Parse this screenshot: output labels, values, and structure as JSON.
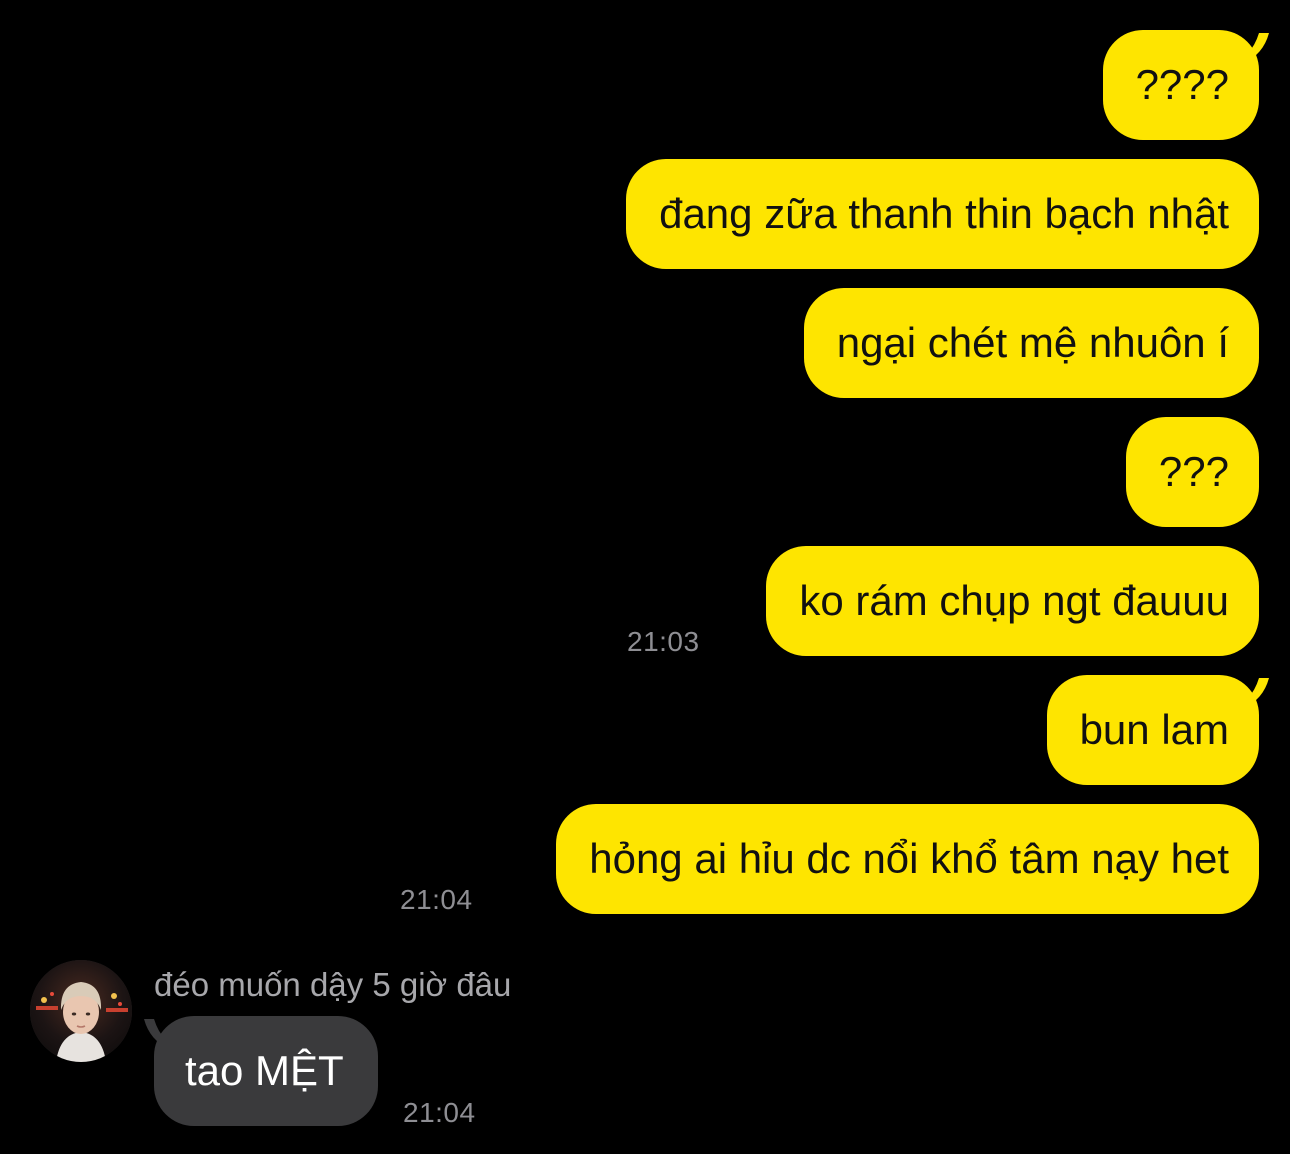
{
  "colors": {
    "background": "#000000",
    "outgoing_bubble": "#FEE500",
    "incoming_bubble": "#3a3a3c",
    "timestamp": "#8e8e93"
  },
  "messages_out": [
    {
      "text": "????"
    },
    {
      "text": "đang zữa thanh thin bạch nhật"
    },
    {
      "text": "ngại chét mệ nhuôn í"
    },
    {
      "text": "???"
    },
    {
      "text": "ko rám chụp ngt đauuu",
      "time": "21:03"
    },
    {
      "text": "bun lam"
    },
    {
      "text": "hỏng ai hỉu dc nổi khổ tâm nạy het",
      "time": "21:04"
    }
  ],
  "incoming": {
    "sender_name": "đéo muốn dậy 5 giờ đâu",
    "avatar_icon": "profile-photo",
    "text": "tao MỆT",
    "time": "21:04"
  }
}
